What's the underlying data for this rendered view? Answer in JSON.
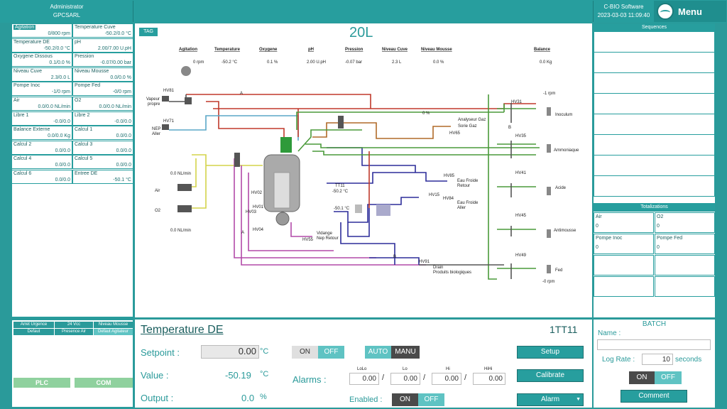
{
  "header": {
    "user": "Administrator",
    "company": "GPCSARL",
    "software": "C-BIO Software",
    "datetime": "2023-03-03 11:09:40",
    "menu": "Menu"
  },
  "left_cells": [
    {
      "name": "Agitation",
      "value": "0/800 rpm",
      "sel": true
    },
    {
      "name": "Temperature Cuve",
      "value": "-50.2/0.0 °C"
    },
    {
      "name": "Temperature DE",
      "value": "-50.2/0.0 °C"
    },
    {
      "name": "pH",
      "value": "2.00/7.00 U.pH"
    },
    {
      "name": "Oxygene Dissous",
      "value": "0.1/0.0 %"
    },
    {
      "name": "Pression",
      "value": "-0.07/0.00 bar"
    },
    {
      "name": "Niveau Cuve",
      "value": "2.3/0.0 L"
    },
    {
      "name": "Niveau Mousse",
      "value": "0.0/0.0 %"
    },
    {
      "name": "Pompe Inoc",
      "value": "-1/0 rpm"
    },
    {
      "name": "Pompe Fed",
      "value": "-0/0 rpm"
    },
    {
      "name": "Air",
      "value": "0.0/0.0 NL/min"
    },
    {
      "name": "O2",
      "value": "0.0/0.0 NL/min"
    },
    {
      "name": "Libre 1",
      "value": "-0.0/0.0"
    },
    {
      "name": "Libre 2",
      "value": "-0.0/0.0"
    },
    {
      "name": "Balance Externe",
      "value": "0.0/0.0 Kg"
    },
    {
      "name": "Calcul 1",
      "value": "0.0/0.0"
    },
    {
      "name": "Calcul 2",
      "value": "0.0/0.0"
    },
    {
      "name": "Calcul 3",
      "value": "0.0/0.0"
    },
    {
      "name": "Calcul 4",
      "value": "0.0/0.0"
    },
    {
      "name": "Calcul 5",
      "value": "0.0/0.0"
    },
    {
      "name": "Calcul 6",
      "value": "0.0/0.0"
    },
    {
      "name": "Entree DE",
      "value": "-50.1 °C"
    }
  ],
  "synoptic": {
    "tag": "TAG",
    "title": "20L",
    "heads": [
      "Agitation",
      "Temperature",
      "Oxygene",
      "pH",
      "Pression",
      "Niveau Cuve",
      "Niveau Mousse",
      "Balance"
    ],
    "vals": [
      "0 rpm",
      "-50.2 °C",
      "0.1 %",
      "2.00 U.pH",
      "-0.07 bar",
      "2.3 L",
      "0.0 %",
      "0.0 Kg"
    ],
    "labels": {
      "hv81": "HV81",
      "vapeur": "Vapeur",
      "propre": "propre",
      "hv71": "HV71",
      "nep": "NEP",
      "aller": "Aller",
      "a1": "A",
      "hv31": "HV31",
      "rpm": "-1 rpm",
      "inoculum": "Inoculum",
      "b1": "B",
      "pct": "0 %",
      "analyseur": "Analyseur Gaz",
      "sortie": "Sorie Gaz",
      "hv65": "HV65",
      "hv35": "HV35",
      "ammoniaque": "Ammoniaque",
      "hv41": "HV41",
      "acide": "Acide",
      "hv45": "HV45",
      "antimousse": "Antimousse",
      "hv49": "HV49",
      "fed": "Fed",
      "fedrpm": "-0 rpm",
      "airflow": "0.0 NL/min",
      "air": "Air",
      "o2": "O2",
      "o2flow": "0.0 NL/min",
      "hv02": "HV02",
      "hv01": "HV01",
      "hv03": "HV03",
      "hv04": "HV04",
      "a2": "A",
      "tt11": "TT11",
      "tt11v": "-50.2 °C",
      "tt2v": "-50.1 °C",
      "hv85": "HV85",
      "eaufroide1": "Eau Froide",
      "retour": "Retour",
      "hv15": "HV15",
      "hv84": "HV84",
      "eaufroide2": "Eau Froide",
      "aller2": "Aller",
      "vidange": "Vidange",
      "nepretour": "Nep Retour",
      "hv55": "HV55",
      "hv91": "HV91",
      "drain": "Drain",
      "produits": "Produits biologiques",
      "b2": "B"
    }
  },
  "sequences": {
    "title": "Sequences"
  },
  "totalizations": {
    "title": "Totalizations",
    "items": [
      {
        "name": "Air",
        "value": "0"
      },
      {
        "name": "O2",
        "value": "0"
      },
      {
        "name": "Pompe Inoc",
        "value": "0"
      },
      {
        "name": "Pompe Fed",
        "value": "0"
      }
    ]
  },
  "status": {
    "btns": [
      "Arret Urgence",
      "24 Vcc",
      "Niveau Mousse",
      "Defaut",
      "Presence Air",
      "Defaut Agitateur"
    ],
    "plc": "PLC",
    "com": "COM"
  },
  "control": {
    "title": "Temperature DE",
    "tag": "1TT11",
    "setpoint_label": "Setpoint :",
    "setpoint": "0.00",
    "unit": "°C",
    "value_label": "Value :",
    "value": "-50.19",
    "output_label": "Output :",
    "output": "0.0",
    "pct": "%",
    "on": "ON",
    "off": "OFF",
    "auto": "AUTO",
    "manu": "MANU",
    "alarms_label": "Alarms :",
    "lolo": "LoLo",
    "lo": "Lo",
    "hi": "Hi",
    "hihi": "HiHi",
    "lolo_v": "0.00",
    "lo_v": "0.00",
    "hi_v": "0.00",
    "hihi_v": "0.00",
    "slash": "/",
    "enabled_label": "Enabled :",
    "setup": "Setup",
    "calibrate": "Calibrate",
    "alarm": "Alarm"
  },
  "batch": {
    "title": "BATCH",
    "name_label": "Name :",
    "name": "",
    "lograte_label": "Log Rate :",
    "lograte": "10",
    "seconds": "seconds",
    "on": "ON",
    "off": "OFF",
    "comment": "Comment"
  }
}
